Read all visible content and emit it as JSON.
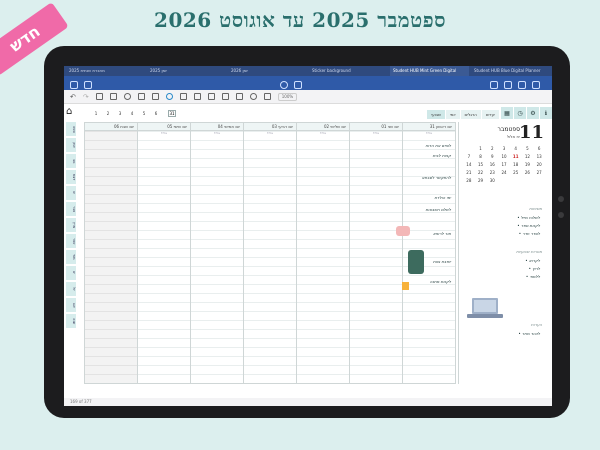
{
  "headline": "ספטמבר 2025 עד אוגוסט 2026",
  "badge": "חדש",
  "tabs": [
    "מחברת שנתית 2025",
    "יומן 2025",
    "יומן 2026",
    "Sticker background",
    "Student HUB Mint Green Digital",
    "Student HUB Blue Digital Planner"
  ],
  "zoom_label": "100%",
  "nav": {
    "numbers": [
      "1",
      "2",
      "3",
      "4",
      "5",
      "6"
    ],
    "box": "31"
  },
  "category_tabs": [
    "שבועי",
    "יומי",
    "הרגלים",
    "יעדים"
  ],
  "left_tabs": [
    "ספט",
    "אוק",
    "נוב",
    "דצמ",
    "ינו",
    "פבר",
    "מרץ",
    "אפר",
    "מאי",
    "יונ",
    "יול",
    "אוג",
    "שנה"
  ],
  "days": [
    {
      "head": "יום שבת 06",
      "sub": "",
      "shade": true
    },
    {
      "head": "יום שישי 05",
      "sub": "אלול",
      "shade": false
    },
    {
      "head": "יום חמישי 04",
      "sub": "אלול",
      "shade": false
    },
    {
      "head": "יום רביעי 03",
      "sub": "אלול",
      "shade": false
    },
    {
      "head": "יום שלישי 02",
      "sub": "אלול",
      "shade": false
    },
    {
      "head": "יום שני 01",
      "sub": "אלול",
      "shade": false
    },
    {
      "head": "יום ראשון 31",
      "sub": "אלול",
      "shade": false
    }
  ],
  "handwriting": [
    "לסיים את הדוח",
    "קניות לבית",
    "להתקשר לסבתא",
    "ימי הולדת",
    "לשלם חשבונות",
    "תור לרופא",
    "ישיבת צוות",
    "לקנות מתנה"
  ],
  "side": {
    "bignum": "11",
    "month": "ספטמבר",
    "hebdate": "יח אלול",
    "cal": [
      "",
      "1",
      "2",
      "3",
      "4",
      "5",
      "6",
      "7",
      "8",
      "9",
      "10",
      "11",
      "12",
      "13",
      "14",
      "15",
      "16",
      "17",
      "18",
      "19",
      "20",
      "21",
      "22",
      "23",
      "24",
      "25",
      "26",
      "27",
      "28",
      "29",
      "30"
    ],
    "highlight": "11",
    "sections": [
      {
        "title": "משימות",
        "items": [
          "לשלוח מייל",
          "לקנות ספר",
          "לסדר חדר"
        ]
      },
      {
        "title": "מטרות שבועיות",
        "items": [
          "לקרוא",
          "לרוץ",
          "ללמוד"
        ]
      },
      {
        "title": "הערות",
        "items": [
          "לזכור מחר"
        ]
      }
    ]
  },
  "footer": "169 of 377"
}
